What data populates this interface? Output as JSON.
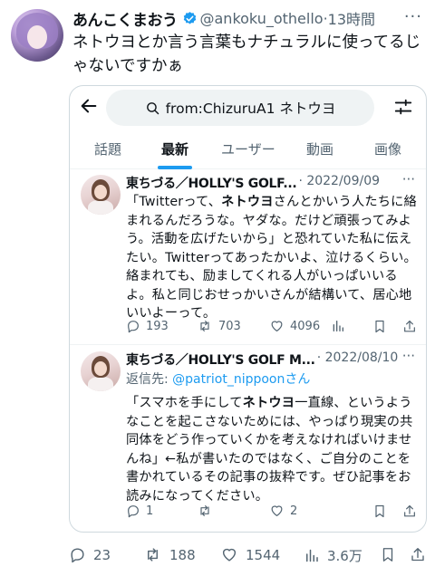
{
  "tweet": {
    "display_name": "あんこくまおう",
    "handle": "@ankoku_othello",
    "time": "13時間",
    "more": "···",
    "text": "ネトウヨとか言う言葉もナチュラルに使ってるじゃないですかぁ"
  },
  "quote": {
    "search_query": "from:ChizuruA1 ネトウヨ",
    "tabs": [
      "話題",
      "最新",
      "ユーザー",
      "動画",
      "画像"
    ],
    "active_tab": "最新",
    "posts": [
      {
        "name": "東ちづる／HOLLY'S GOLF...",
        "date": "· 2022/09/09",
        "more": "···",
        "body_pre": "「Twitterって、",
        "body_bold": "ネトウヨ",
        "body_post": "さんとかいう人たちに絡まれるんだろうな。ヤダな。だけど頑張ってみよう。活動を広げたいから」と恐れていた私に伝えたい。Twitterってあったかいよ、泣けるくらい。絡まれても、励ましてくれる人がいっぱいいるよ。私と同じおせっかいさんが結構いて、居心地いいよーって。",
        "replies": "193",
        "retweets": "703",
        "likes": "4096"
      },
      {
        "name": "東ちづる／HOLLY'S GOLF M...",
        "date": "· 2022/08/10",
        "more": "···",
        "reply_label": "返信先: ",
        "reply_mention": "@patriot_nippoon",
        "reply_suffix": "さん",
        "body_pre": "「スマホを手にして",
        "body_bold": "ネトウヨ",
        "body_post": "一直線、というようなことを起こさないためには、やっぱり現実の共同体をどう作っていくかを考えなければいけませんね」←私が書いたのではなく、ご自分のことを書かれているその記事の抜粋です。ぜひ記事をお読みになってください。",
        "replies": "1",
        "retweets": "",
        "likes": "2"
      }
    ]
  },
  "bottom_actions": {
    "replies": "23",
    "retweets": "188",
    "likes": "1544",
    "views": "3.6万"
  },
  "colors": {
    "accent": "#1d9bf0",
    "text": "#0f1419",
    "muted": "#536471"
  }
}
